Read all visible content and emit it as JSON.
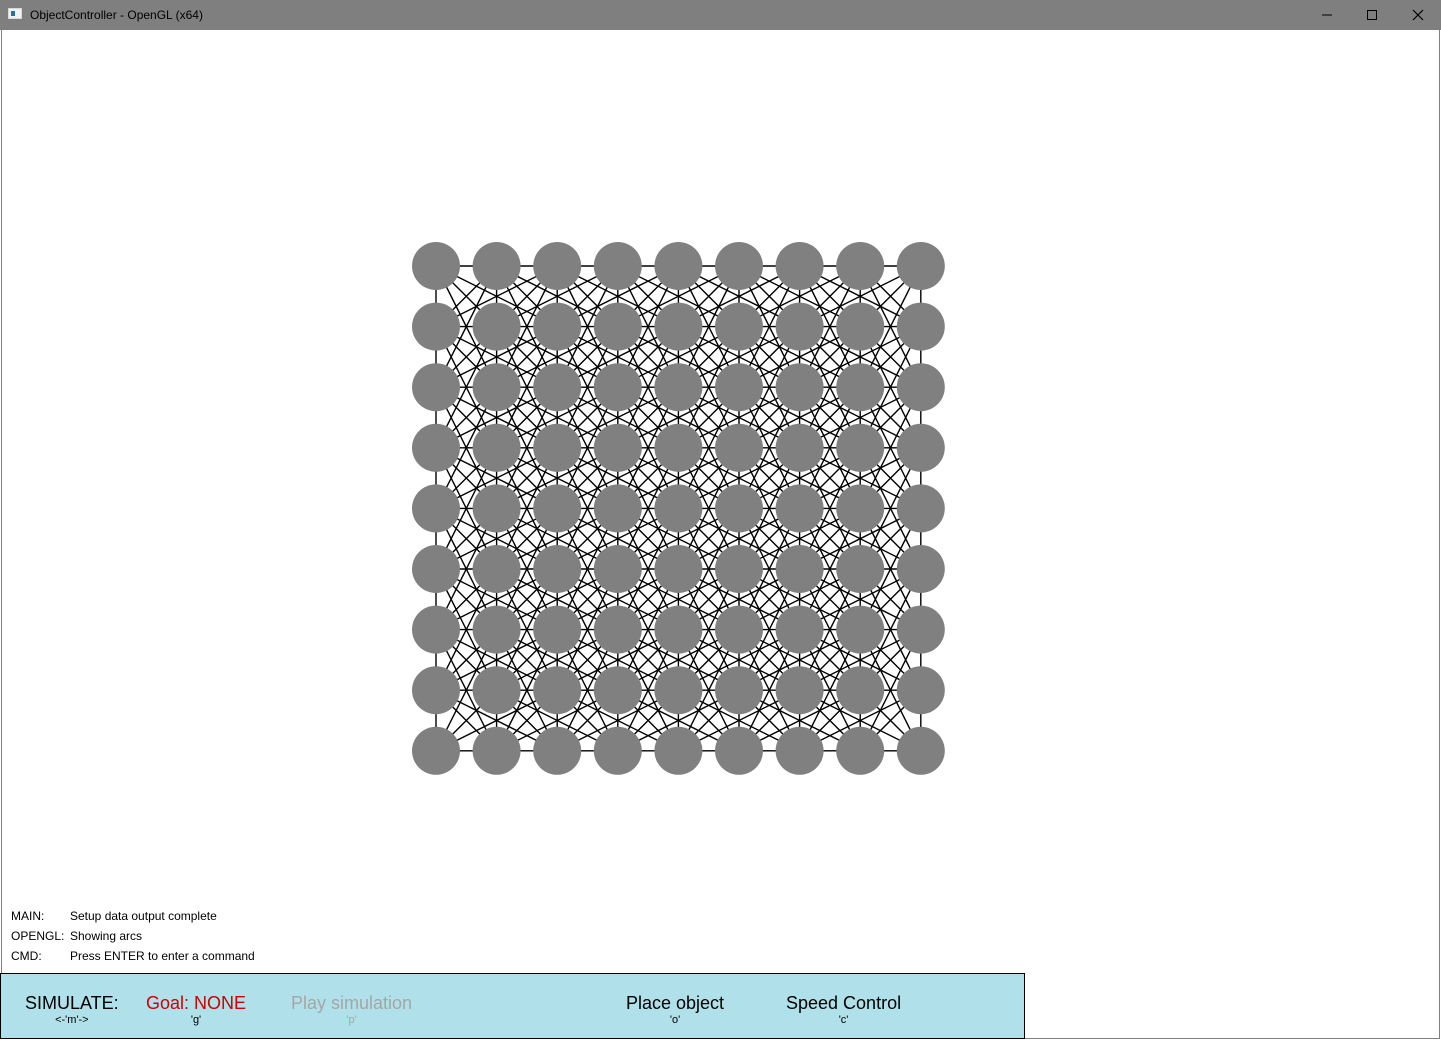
{
  "window": {
    "title": "ObjectController - OpenGL (x64)",
    "controls": [
      "minimize-icon",
      "maximize-icon",
      "close-icon"
    ]
  },
  "scene": {
    "grid": {
      "rows": 9,
      "columns": 9
    },
    "node_color": "#808080",
    "arc_color": "#000000",
    "background": "#ffffff"
  },
  "log": [
    {
      "label": "MAIN:",
      "message": "Setup data output complete"
    },
    {
      "label": "OPENGL:",
      "message": "Showing arcs"
    },
    {
      "label": "CMD:",
      "message": "Press ENTER to enter a command"
    }
  ],
  "toolbar": {
    "background": "#b0e0e9",
    "simulate": {
      "label": "SIMULATE:",
      "key": "<-'m'->"
    },
    "goal": {
      "label": "Goal: NONE",
      "key": "'g'",
      "color": "#cc0000"
    },
    "play": {
      "label": "Play simulation",
      "key": "'p'",
      "color": "#a6a6a6"
    },
    "place": {
      "label": "Place object",
      "key": "'o'"
    },
    "speed": {
      "label": "Speed Control",
      "key": "'c'"
    }
  }
}
